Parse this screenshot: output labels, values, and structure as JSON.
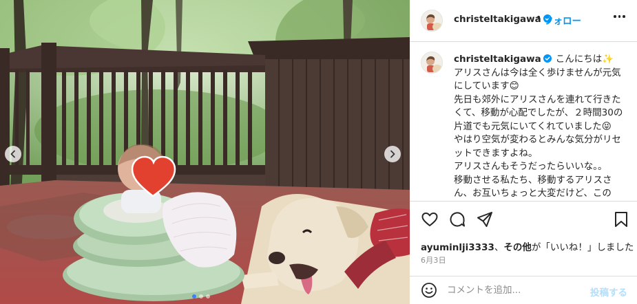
{
  "header": {
    "username": "christeltakigawa",
    "separator": "•",
    "follow_label": "フォロー",
    "more_icon": "more-horizontal-icon"
  },
  "caption": {
    "username": "christeltakigawa",
    "lines": [
      "こんにちは✨",
      "アリスさんは今は全く歩けませんが元気にしています😊",
      "先日も郊外にアリスさんを連れて行きたくて、移動が心配でしたが、２時間30の片道でも元気にいてくれていました😝",
      "やはり空気が変わるとみんな気分がリセットできますよね。",
      "アリスさんもそうだったらいいな。。",
      "移動させる私たち、移動するアリスさん、お互いちょっと大変だけど、この"
    ]
  },
  "actions": {
    "like_icon": "heart-outline-icon",
    "comment_icon": "comment-icon",
    "share_icon": "paper-plane-icon",
    "save_icon": "bookmark-icon"
  },
  "likes": {
    "user": "ayuminlji3333",
    "others": "その他",
    "suffix_before": "、",
    "suffix_after": "が「いいね！」しました"
  },
  "date": "6月3日",
  "comment": {
    "placeholder": "コメントを追加...",
    "post_label": "投稿する",
    "emoji_icon": "emoji-smile-icon"
  },
  "media": {
    "prev_icon": "chevron-left-icon",
    "next_icon": "chevron-right-icon",
    "carousel_total": 3,
    "carousel_active": 1,
    "accent": "#0095f6",
    "verified_color": "#0095f6"
  }
}
